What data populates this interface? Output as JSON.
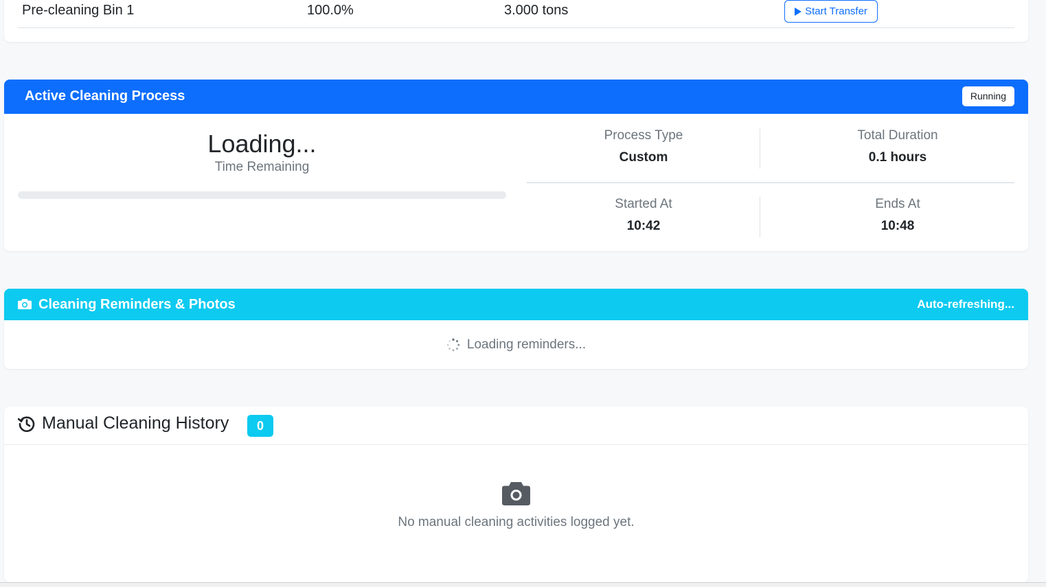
{
  "bins": {
    "rows": [
      {
        "name": "Pre-cleaning Bin 1",
        "percent": "100.0%",
        "weight": "3.000 tons",
        "action_label": "Start Transfer"
      }
    ]
  },
  "process": {
    "title": "Active Cleaning Process",
    "status_badge": "Running",
    "countdown_value": "Loading...",
    "countdown_label": "Time Remaining",
    "progress_percent": 0,
    "stats": {
      "process_type_label": "Process Type",
      "process_type_value": "Custom",
      "total_duration_label": "Total Duration",
      "total_duration_value": "0.1 hours",
      "started_at_label": "Started At",
      "started_at_value": "10:42",
      "ends_at_label": "Ends At",
      "ends_at_value": "10:48"
    },
    "accent_color": "#0d6efd"
  },
  "reminders": {
    "title": "Cleaning Reminders & Photos",
    "refresh_status": "Auto-refreshing...",
    "loading_text": "Loading reminders...",
    "icon": "camera-icon",
    "accent_color": "#0dcaf0"
  },
  "history": {
    "title": "Manual Cleaning History",
    "count": "0",
    "empty_text": "No manual cleaning activities logged yet.",
    "icon": "history-icon",
    "empty_icon": "camera-icon"
  }
}
